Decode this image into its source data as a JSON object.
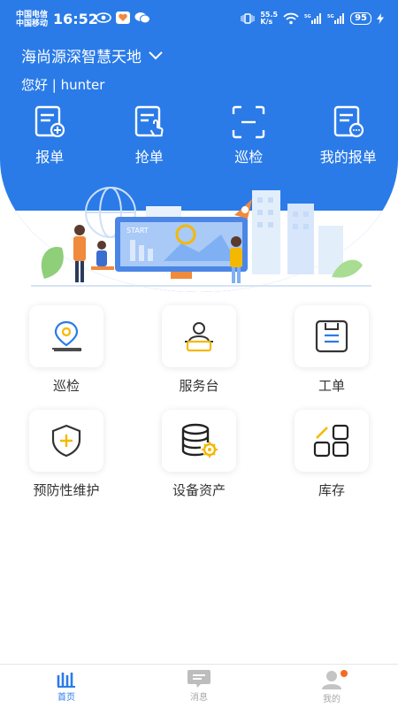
{
  "status": {
    "carrier1": "中国电信",
    "carrier2": "中国移动",
    "time": "16:52",
    "net_speed": "55.5\nK/s",
    "battery": "95"
  },
  "header": {
    "project": "海尚源深智慧天地",
    "greeting": "您好 | hunter"
  },
  "quick": [
    {
      "label": "报单",
      "icon": "report-icon"
    },
    {
      "label": "抢单",
      "icon": "grab-order-icon"
    },
    {
      "label": "巡检",
      "icon": "scan-icon"
    },
    {
      "label": "我的报单",
      "icon": "my-report-icon"
    }
  ],
  "banner": {
    "text": "START"
  },
  "grid": [
    {
      "label": "巡检",
      "icon": "location-pin-icon"
    },
    {
      "label": "服务台",
      "icon": "service-desk-icon"
    },
    {
      "label": "工单",
      "icon": "work-order-icon"
    },
    {
      "label": "预防性维护",
      "icon": "shield-plus-icon"
    },
    {
      "label": "设备资产",
      "icon": "database-gear-icon"
    },
    {
      "label": "库存",
      "icon": "inventory-grid-icon"
    }
  ],
  "tabbar": [
    {
      "label": "首页",
      "active": true
    },
    {
      "label": "消息",
      "active": false
    },
    {
      "label": "我的",
      "active": false
    }
  ],
  "colors": {
    "primary": "#2a7be8",
    "accent": "#f5b800",
    "badge": "#f36b21"
  }
}
